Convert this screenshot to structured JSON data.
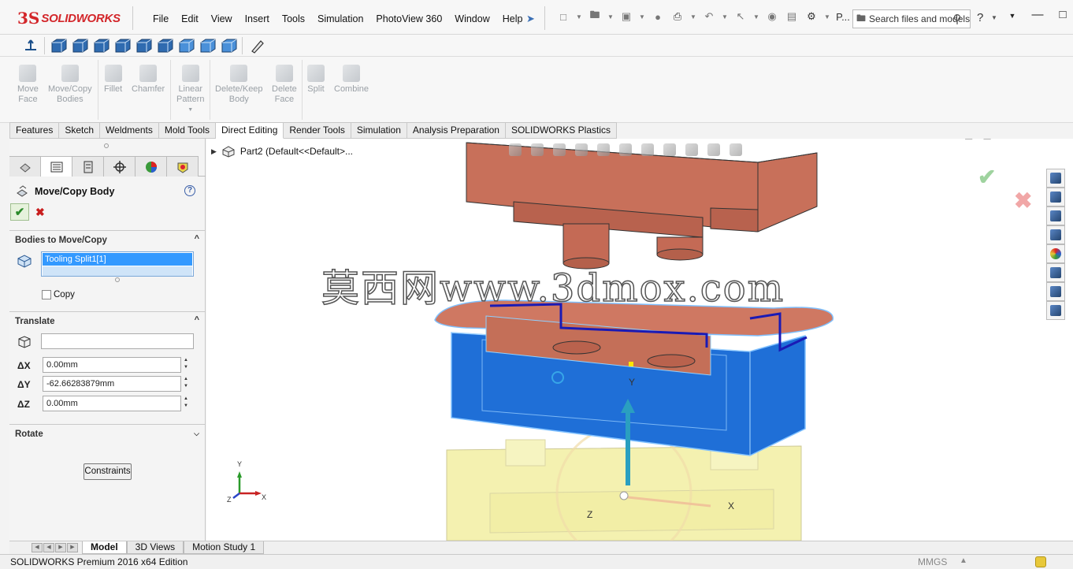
{
  "app": {
    "logo_mark": "3S",
    "logo_text": "SOLIDWORKS",
    "menu": [
      "File",
      "Edit",
      "View",
      "Insert",
      "Tools",
      "Simulation",
      "PhotoView 360",
      "Window",
      "Help"
    ],
    "qat_overflow": "P...",
    "search_placeholder": "Search files and models"
  },
  "ribbon": {
    "buttons": [
      {
        "label": "Move\nFace"
      },
      {
        "label": "Move/Copy\nBodies"
      },
      {
        "label": "Fillet"
      },
      {
        "label": "Chamfer"
      },
      {
        "label": "Linear\nPattern"
      },
      {
        "label": "Delete/Keep\nBody"
      },
      {
        "label": "Delete\nFace"
      },
      {
        "label": "Split"
      },
      {
        "label": "Combine"
      }
    ]
  },
  "tabs": [
    "Features",
    "Sketch",
    "Weldments",
    "Mold Tools",
    "Direct Editing",
    "Render Tools",
    "Simulation",
    "Analysis Preparation",
    "SOLIDWORKS Plastics"
  ],
  "active_tab": "Direct Editing",
  "property_manager": {
    "title": "Move/Copy Body",
    "bodies_group": "Bodies to Move/Copy",
    "selected_body": "Tooling Split1[1]",
    "copy_label": "Copy",
    "copy_checked": false,
    "translate_group": "Translate",
    "reference_value": "",
    "dx_label": "ΔX",
    "dx_value": "0.00mm",
    "dy_label": "ΔY",
    "dy_value": "-62.66283879mm",
    "dz_label": "ΔZ",
    "dz_value": "0.00mm",
    "rotate_group": "Rotate",
    "constraints_label": "Constraints"
  },
  "graphics": {
    "tree_item": "Part2  (Default<<Default>...",
    "watermark": "莫西网www.3dmox.com",
    "triad_labels": {
      "x": "X",
      "y": "Y",
      "z": "Z"
    },
    "manip_labels": {
      "x": "X",
      "y": "Y",
      "z": "Z"
    }
  },
  "bottom_tabs": [
    "Model",
    "3D Views",
    "Motion Study 1"
  ],
  "active_bottom_tab": "Model",
  "status": {
    "edition": "SOLIDWORKS Premium 2016 x64 Edition",
    "units": "MMGS"
  },
  "colors": {
    "mold_top": "#c8705a",
    "mold_core_blue": "#1e6fd9",
    "mold_bottom_yellow": "#f3f0a8",
    "brand_red": "#d3262a"
  }
}
